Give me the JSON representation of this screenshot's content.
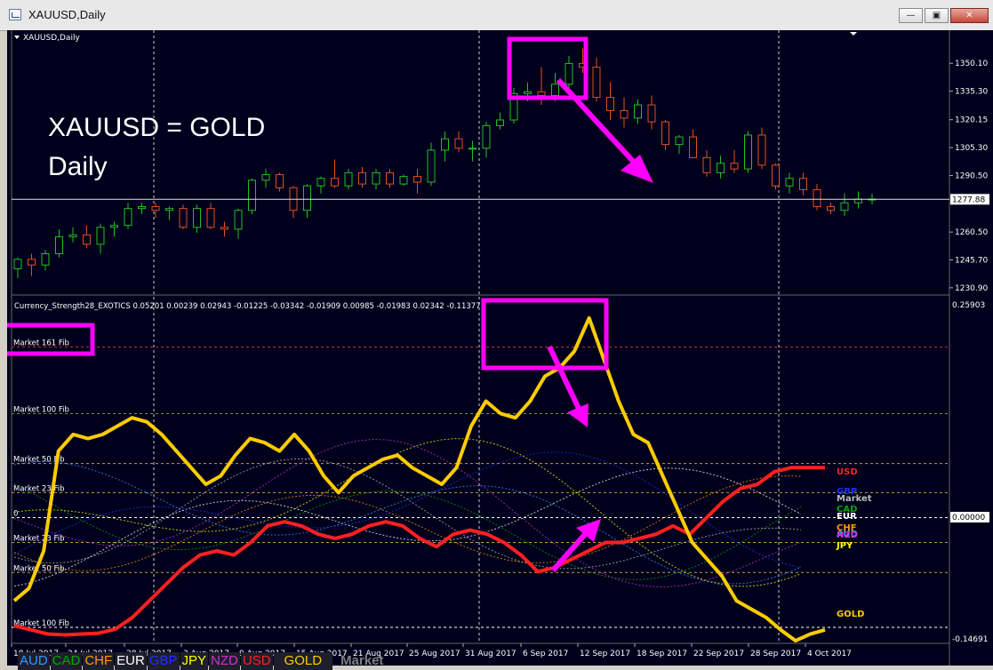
{
  "window": {
    "title": "XAUUSD,Daily"
  },
  "main_chart": {
    "label": "XAUUSD,Daily",
    "price_ticks": [
      "1350.10",
      "1335.30",
      "1320.15",
      "1305.30",
      "1290.50",
      "1277.88",
      "1260.50",
      "1245.70",
      "1230.90"
    ],
    "current_price": "1277.88",
    "annotation_line1": "XAUUSD = GOLD",
    "annotation_line2": "Daily"
  },
  "indicator": {
    "header": "Currency_Strength28_EXOTICS  0.05201 0.00239 0.02943 -0.01225 -0.03342 -0.01909 0.00985 -0.01983 0.02342 -0.11377",
    "top_value": "0.25903",
    "zero_value": "0.00000",
    "bottom_value": "-0.14691",
    "levels": [
      {
        "label": "Market 161 Fib"
      },
      {
        "label": "Market 100 Fib"
      },
      {
        "label": "Market 50 Fib"
      },
      {
        "label": "Market 23 Fib"
      },
      {
        "label": "0"
      },
      {
        "label": "Market 23 Fib"
      },
      {
        "label": "Market 50 Fib"
      },
      {
        "label": "Market 100 Fib"
      }
    ],
    "right_labels": [
      {
        "text": "USD",
        "color": "#ff2020"
      },
      {
        "text": "GBP",
        "color": "#2030ff"
      },
      {
        "text": "Market",
        "color": "#bbbbbb"
      },
      {
        "text": "CAD",
        "color": "#00aa00"
      },
      {
        "text": "EUR",
        "color": "#ffffff"
      },
      {
        "text": "CHF",
        "color": "#ff9900"
      },
      {
        "text": "AUD",
        "color": "#3399ff"
      },
      {
        "text": "NZD",
        "color": "#cc33cc"
      },
      {
        "text": "JPY",
        "color": "#ffff00"
      },
      {
        "text": "GOLD",
        "color": "#ffcc00"
      }
    ],
    "legend": [
      {
        "text": "AUD",
        "color": "#3399ff"
      },
      {
        "text": "CAD",
        "color": "#00aa00"
      },
      {
        "text": "CHF",
        "color": "#ff9900"
      },
      {
        "text": "EUR",
        "color": "#ffffff"
      },
      {
        "text": "GBP",
        "color": "#2030ff"
      },
      {
        "text": "JPY",
        "color": "#ffff00"
      },
      {
        "text": "NZD",
        "color": "#cc33cc"
      },
      {
        "text": "USD",
        "color": "#ff2020"
      },
      {
        "text": "GOLD",
        "color": "#ffcc00"
      }
    ],
    "legend_market": "Market"
  },
  "time_axis": [
    "18 Jul 2017",
    "24 Jul 2017",
    "28 Jul 2017",
    "3 Aug 2017",
    "9 Aug 2017",
    "15 Aug 2017",
    "21 Aug 2017",
    "25 Aug 2017",
    "31 Aug 2017",
    "6 Sep 2017",
    "12 Sep 2017",
    "18 Sep 2017",
    "22 Sep 2017",
    "28 Sep 2017",
    "4 Oct 2017"
  ],
  "colors": {
    "background": "#00001c",
    "bull": "#20c020",
    "bear": "#e05020",
    "highlight": "#ff00ff",
    "gold_line": "#ffcc00",
    "usd_line": "#ff2020"
  },
  "chart_data": {
    "type": "candlestick",
    "title": "XAUUSD,Daily",
    "ylim": [
      1228,
      1362
    ],
    "candles": [
      [
        1241,
        1247,
        1236,
        1246
      ],
      [
        1246,
        1249,
        1237,
        1243
      ],
      [
        1243,
        1251,
        1240,
        1249
      ],
      [
        1249,
        1262,
        1247,
        1258
      ],
      [
        1258,
        1263,
        1255,
        1259
      ],
      [
        1259,
        1264,
        1252,
        1254
      ],
      [
        1254,
        1265,
        1249,
        1263
      ],
      [
        1263,
        1266,
        1258,
        1264
      ],
      [
        1264,
        1276,
        1262,
        1273
      ],
      [
        1273,
        1276,
        1270,
        1274
      ],
      [
        1274,
        1276,
        1268,
        1272
      ],
      [
        1272,
        1274,
        1267,
        1273
      ],
      [
        1273,
        1275,
        1262,
        1263
      ],
      [
        1263,
        1275,
        1260,
        1273
      ],
      [
        1273,
        1276,
        1262,
        1263
      ],
      [
        1263,
        1266,
        1258,
        1262
      ],
      [
        1262,
        1273,
        1257,
        1272
      ],
      [
        1272,
        1289,
        1270,
        1288
      ],
      [
        1288,
        1294,
        1284,
        1291
      ],
      [
        1291,
        1292,
        1282,
        1284
      ],
      [
        1284,
        1285,
        1268,
        1272
      ],
      [
        1272,
        1286,
        1268,
        1285
      ],
      [
        1285,
        1290,
        1281,
        1289
      ],
      [
        1289,
        1299,
        1284,
        1285
      ],
      [
        1285,
        1294,
        1283,
        1292
      ],
      [
        1292,
        1295,
        1284,
        1286
      ],
      [
        1286,
        1294,
        1283,
        1292
      ],
      [
        1292,
        1294,
        1284,
        1286
      ],
      [
        1286,
        1291,
        1285,
        1290
      ],
      [
        1290,
        1294,
        1281,
        1287
      ],
      [
        1287,
        1308,
        1285,
        1304
      ],
      [
        1304,
        1314,
        1298,
        1310
      ],
      [
        1310,
        1314,
        1303,
        1305
      ],
      [
        1305,
        1309,
        1298,
        1305
      ],
      [
        1305,
        1319,
        1300,
        1317
      ],
      [
        1317,
        1324,
        1315,
        1320
      ],
      [
        1320,
        1337,
        1318,
        1334
      ],
      [
        1334,
        1340,
        1330,
        1335
      ],
      [
        1335,
        1348,
        1328,
        1333
      ],
      [
        1333,
        1345,
        1330,
        1339
      ],
      [
        1339,
        1354,
        1337,
        1350
      ],
      [
        1350,
        1358,
        1345,
        1348
      ],
      [
        1348,
        1353,
        1330,
        1332
      ],
      [
        1332,
        1340,
        1320,
        1325
      ],
      [
        1325,
        1332,
        1316,
        1321
      ],
      [
        1321,
        1331,
        1318,
        1328
      ],
      [
        1328,
        1333,
        1315,
        1319
      ],
      [
        1319,
        1320,
        1304,
        1307
      ],
      [
        1307,
        1312,
        1302,
        1311
      ],
      [
        1311,
        1315,
        1300,
        1300
      ],
      [
        1300,
        1304,
        1290,
        1292
      ],
      [
        1292,
        1301,
        1289,
        1297
      ],
      [
        1297,
        1304,
        1292,
        1294
      ],
      [
        1294,
        1314,
        1292,
        1312
      ],
      [
        1312,
        1316,
        1294,
        1296
      ],
      [
        1296,
        1297,
        1283,
        1285
      ],
      [
        1285,
        1292,
        1281,
        1289
      ],
      [
        1289,
        1292,
        1280,
        1283
      ],
      [
        1283,
        1286,
        1272,
        1274
      ],
      [
        1274,
        1276,
        1270,
        1272
      ],
      [
        1272,
        1281,
        1269,
        1276
      ],
      [
        1276,
        1282,
        1273,
        1278
      ],
      [
        1278,
        1281,
        1275,
        1278
      ]
    ],
    "indicator_series": {
      "GOLD": [
        -0.1,
        -0.085,
        -0.04,
        0.08,
        0.1,
        0.095,
        0.1,
        0.11,
        0.12,
        0.115,
        0.1,
        0.08,
        0.06,
        0.04,
        0.05,
        0.075,
        0.095,
        0.09,
        0.08,
        0.1,
        0.08,
        0.05,
        0.03,
        0.05,
        0.06,
        0.07,
        0.075,
        0.06,
        0.05,
        0.04,
        0.06,
        0.11,
        0.14,
        0.125,
        0.12,
        0.14,
        0.17,
        0.18,
        0.2,
        0.24,
        0.19,
        0.14,
        0.1,
        0.09,
        0.05,
        0.01,
        -0.03,
        -0.05,
        -0.07,
        -0.1,
        -0.11,
        -0.12,
        -0.135,
        -0.148,
        -0.14,
        -0.135
      ],
      "USD": [
        -0.13,
        -0.135,
        -0.14,
        -0.141,
        -0.14,
        -0.139,
        -0.134,
        -0.12,
        -0.1,
        -0.08,
        -0.06,
        -0.045,
        -0.04,
        -0.045,
        -0.03,
        -0.01,
        -0.005,
        -0.01,
        -0.02,
        -0.025,
        -0.02,
        -0.01,
        -0.005,
        -0.01,
        -0.025,
        -0.035,
        -0.02,
        -0.015,
        -0.02,
        -0.03,
        -0.045,
        -0.065,
        -0.06,
        -0.05,
        -0.04,
        -0.03,
        -0.03,
        -0.025,
        -0.02,
        -0.01,
        -0.02,
        0.0,
        0.02,
        0.035,
        0.04,
        0.055,
        0.06,
        0.06,
        0.06
      ]
    },
    "xlabels": [
      "18 Jul 2017",
      "24 Jul 2017",
      "28 Jul 2017",
      "3 Aug 2017",
      "9 Aug 2017",
      "15 Aug 2017",
      "21 Aug 2017",
      "25 Aug 2017",
      "31 Aug 2017",
      "6 Sep 2017",
      "12 Sep 2017",
      "18 Sep 2017",
      "22 Sep 2017",
      "28 Sep 2017",
      "4 Oct 2017"
    ]
  }
}
